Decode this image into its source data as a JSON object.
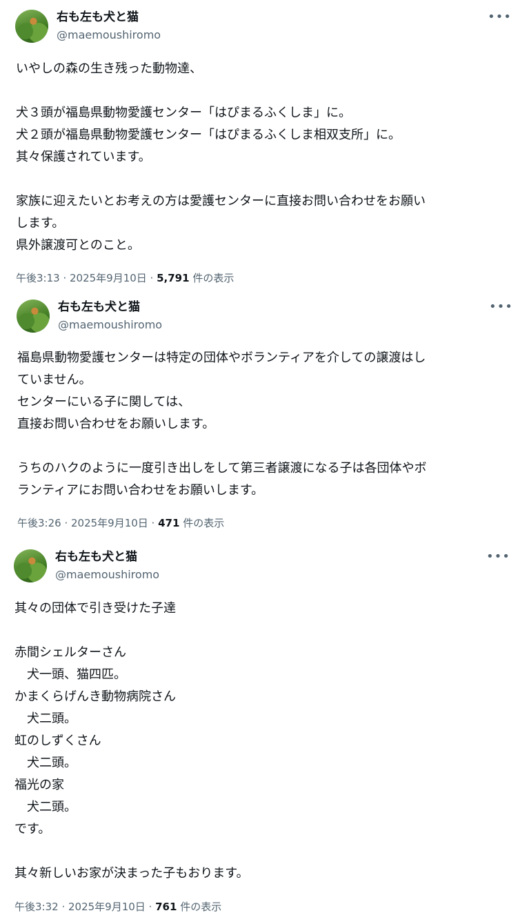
{
  "tweets": [
    {
      "name": "右も左も犬と猫",
      "handle": "@maemoushiromo",
      "more": "•••",
      "text": "いやしの森の生き残った動物達、\n\n犬３頭が福島県動物愛護センター「はぴまるふくしま」に。\n犬２頭が福島県動物愛護センター「はぴまるふくしま相双支所」に。\n其々保護されています。\n\n家族に迎えたいとお考えの方は愛護センターに直接お問い合わせをお願い\nします。\n県外譲渡可とのこと。",
      "time": "午後3:13 · 2025年9月10日 · ",
      "views": "5,791",
      "views_label": " 件の表示"
    },
    {
      "name": "右も左も犬と猫",
      "handle": "@maemoushiromo",
      "more": "•••",
      "text": "福島県動物愛護センターは特定の団体やボランティアを介しての譲渡はし\nていません。\nセンターにいる子に関しては、\n直接お問い合わせをお願いします。\n\nうちのハクのように一度引き出しをして第三者譲渡になる子は各団体やボ\nランティアにお問い合わせをお願いします。",
      "time": "午後3:26 · 2025年9月10日 · ",
      "views": "471",
      "views_label": " 件の表示"
    },
    {
      "name": "右も左も犬と猫",
      "handle": "@maemoushiromo",
      "more": "•••",
      "text": "其々の団体で引き受けた子達\n\n赤間シェルターさん\n　犬一頭、猫四匹。\nかまくらげんき動物病院さん\n　犬二頭。\n虹のしずくさん\n　犬二頭。\n福光の家\n　犬二頭。\nです。\n\n其々新しいお家が決まった子もおります。",
      "time": "午後3:32 · 2025年9月10日 · ",
      "views": "761",
      "views_label": " 件の表示"
    }
  ]
}
